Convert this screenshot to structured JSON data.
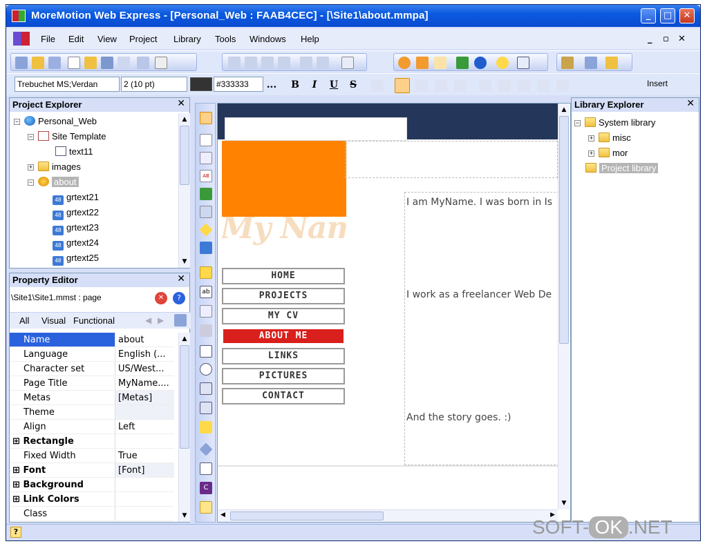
{
  "window": {
    "title": "MoreMotion Web Express - [Personal_Web : FAAB4CEC] - [\\Site1\\about.mmpa]",
    "min": "_",
    "max": "□",
    "close": "✕"
  },
  "menu": {
    "items": [
      "File",
      "Edit",
      "View",
      "Project",
      "Library",
      "Tools",
      "Windows",
      "Help"
    ],
    "mdi_min": "_",
    "mdi_restore": "▫",
    "mdi_close": "✕"
  },
  "format": {
    "font": "Trebuchet MS;Verdan",
    "size": "2  (10 pt)",
    "color_value": "#333333",
    "more": "...",
    "bold": "B",
    "italic": "I",
    "underline": "U",
    "strike": "S",
    "insert_label": "Insert"
  },
  "project_explorer": {
    "title": "Project Explorer",
    "close": "✕",
    "items": [
      "Personal_Web",
      "Site Template",
      "text11",
      "images",
      "about",
      "grtext21",
      "grtext22",
      "grtext23",
      "grtext24",
      "grtext25"
    ],
    "badge": "48"
  },
  "property_editor": {
    "title": "Property Editor",
    "close": "✕",
    "path": "\\Site1\\Site1.mmst : page",
    "tabs": [
      "All",
      "Visual",
      "Functional"
    ],
    "properties": [
      {
        "name": "Name",
        "value": "about"
      },
      {
        "name": "Language",
        "value": "English (..."
      },
      {
        "name": "Character set",
        "value": "US/West..."
      },
      {
        "name": "Page Title",
        "value": "MyName...."
      },
      {
        "name": "Metas",
        "value": "[Metas]"
      },
      {
        "name": "Theme",
        "value": ""
      },
      {
        "name": "Align",
        "value": "Left"
      },
      {
        "name": "Rectangle",
        "value": ""
      },
      {
        "name": "Fixed Width",
        "value": "True"
      },
      {
        "name": "Font",
        "value": "[Font]"
      },
      {
        "name": "Background",
        "value": ""
      },
      {
        "name": "Link Colors",
        "value": ""
      },
      {
        "name": "Class",
        "value": ""
      }
    ],
    "category_prefix": "⊞"
  },
  "library_explorer": {
    "title": "Library Explorer",
    "close": "✕",
    "items": [
      "System library",
      "misc",
      "mor",
      "Project library"
    ]
  },
  "designer": {
    "logo_text": "My Name .com",
    "nav": [
      "HOME",
      "PROJECTS",
      "MY CV",
      "ABOUT ME",
      "LINKS",
      "PICTURES",
      "CONTACT"
    ],
    "para1": "I am MyName. I was born in Is",
    "para2": "I work as a freelancer Web De",
    "para3": "And the story goes.  :)"
  },
  "status": {
    "help": "?"
  },
  "watermark": {
    "soft": "SOFT-",
    "ok": "OK",
    "net": ".NET"
  },
  "colors": {
    "accent": "#0a5ae0",
    "nav_active": "#d9201c",
    "header_navy": "#24375a",
    "logo_orange": "#ff8200"
  }
}
